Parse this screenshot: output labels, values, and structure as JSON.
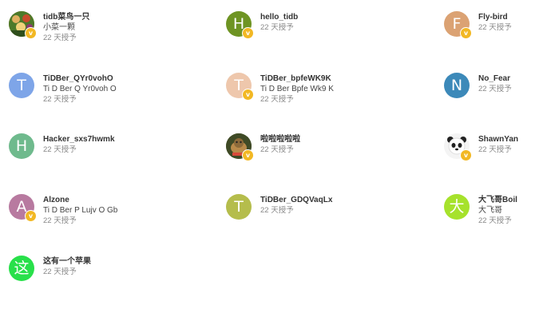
{
  "users": [
    {
      "name": "tidb菜鸟一只",
      "fullname": "小菜一颗",
      "meta": "22 天授予",
      "letter": "",
      "avatar_icon": "photo-avatar-crowd",
      "color": "#c98a3a",
      "verified": true
    },
    {
      "name": "hello_tidb",
      "fullname": "",
      "meta": "22 天授予",
      "letter": "H",
      "avatar_icon": "",
      "color": "#6e9423",
      "verified": true
    },
    {
      "name": "Fly-bird",
      "fullname": "",
      "meta": "22 天授予",
      "letter": "F",
      "avatar_icon": "",
      "color": "#dba273",
      "verified": true
    },
    {
      "name": "TiDBer_QYr0vohO",
      "fullname": "Ti D Ber Q Yr0voh O",
      "meta": "22 天授予",
      "letter": "T",
      "avatar_icon": "",
      "color": "#7ea5e8",
      "verified": false
    },
    {
      "name": "TiDBer_bpfeWK9K",
      "fullname": "Ti D Ber Bpfe Wk9 K",
      "meta": "22 天授予",
      "letter": "T",
      "avatar_icon": "",
      "color": "#eec7ac",
      "verified": true
    },
    {
      "name": "No_Fear",
      "fullname": "",
      "meta": "22 天授予",
      "letter": "N",
      "avatar_icon": "",
      "color": "#3c89b9",
      "verified": false
    },
    {
      "name": "Hacker_sxs7hwmk",
      "fullname": "",
      "meta": "22 天授予",
      "letter": "H",
      "avatar_icon": "",
      "color": "#6fba8d",
      "verified": false
    },
    {
      "name": "啦啦啦啦啦",
      "fullname": "",
      "meta": "22 天授予",
      "letter": "",
      "avatar_icon": "photo-avatar-cat",
      "color": "#5a6a3a",
      "verified": true
    },
    {
      "name": "ShawnYan",
      "fullname": "",
      "meta": "22 天授予",
      "letter": "",
      "avatar_icon": "panda-avatar",
      "color": "#ffffff",
      "verified": true
    },
    {
      "name": "Alzone",
      "fullname": "Ti D Ber P Lujv O Gb",
      "meta": "22 天授予",
      "letter": "A",
      "avatar_icon": "",
      "color": "#b87aa0",
      "verified": true
    },
    {
      "name": "TiDBer_GDQVaqLx",
      "fullname": "",
      "meta": "22 天授予",
      "letter": "T",
      "avatar_icon": "",
      "color": "#b5bd4c",
      "verified": false
    },
    {
      "name": "大飞哥Boil",
      "fullname": "大飞哥",
      "meta": "22 天授予",
      "letter": "大",
      "avatar_icon": "",
      "color": "#a6e22c",
      "verified": false
    },
    {
      "name": "这有一个苹果",
      "fullname": "",
      "meta": "22 天授予",
      "letter": "这",
      "avatar_icon": "",
      "color": "#28e04a",
      "verified": false
    }
  ],
  "badge_symbol": "v",
  "badge_color": "#f2b824"
}
